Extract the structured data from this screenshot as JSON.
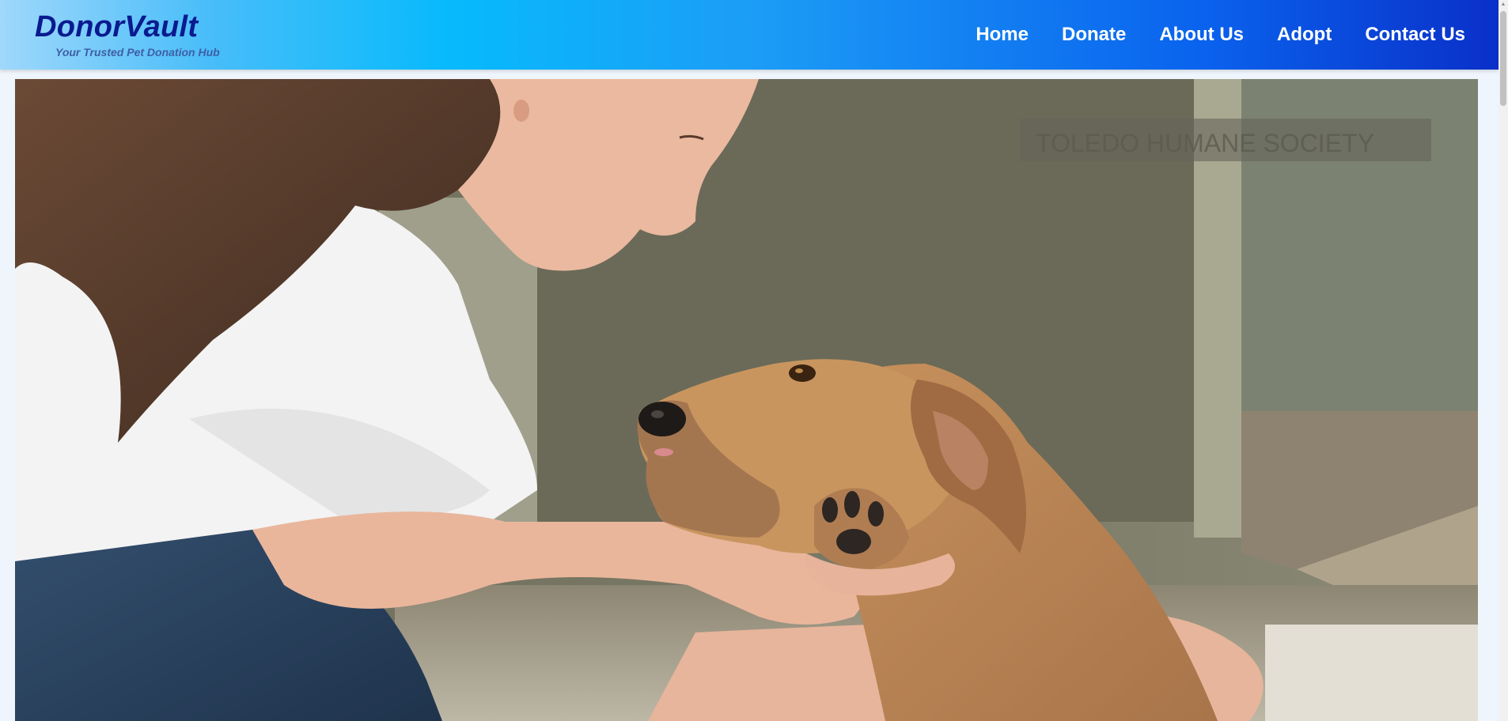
{
  "brand": {
    "title": "DonorVault",
    "tagline": "Your Trusted Pet Donation Hub"
  },
  "nav": {
    "items": [
      "Home",
      "Donate",
      "About Us",
      "Adopt",
      "Contact Us"
    ]
  },
  "hero": {
    "sign_text": "TOLEDO HUMANE SOCIETY",
    "alt": "woman holding a dog's paw"
  },
  "colors": {
    "brand_dark": "#0a1a8f",
    "nav_gradient_start": "#9fd8fb",
    "nav_gradient_end": "#0a30c9",
    "nav_text": "#ffffff"
  }
}
